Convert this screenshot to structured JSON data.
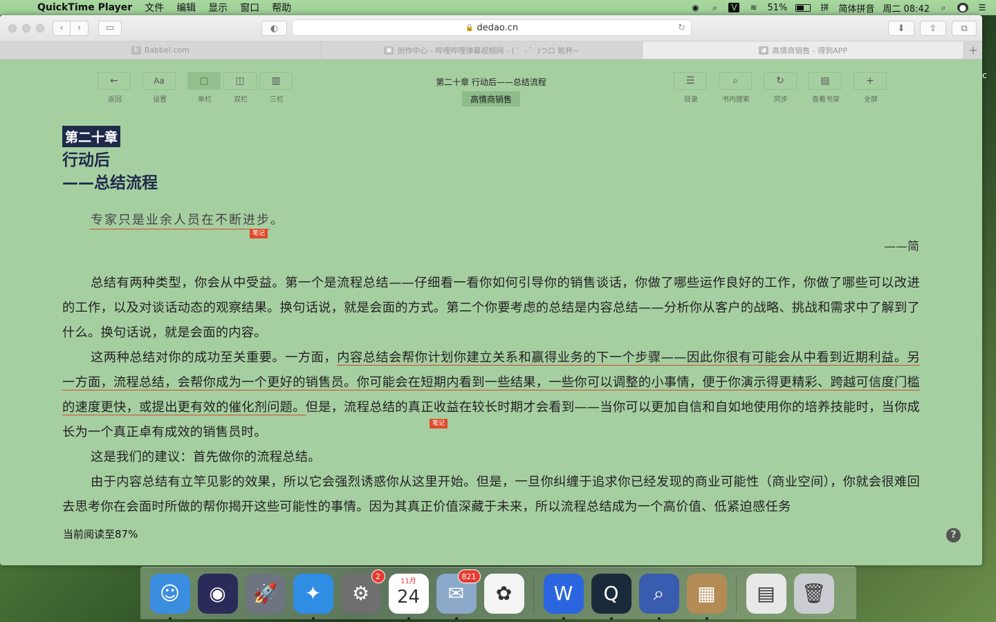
{
  "menubar": {
    "app_name": "QuickTime Player",
    "items": [
      "文件",
      "编辑",
      "显示",
      "窗口",
      "帮助"
    ],
    "battery": "51%",
    "input_method": "简体拼音",
    "clock": "周二 08:42"
  },
  "browser": {
    "url": "dedao.cn",
    "tabs": [
      {
        "label": "Babbel.com",
        "icon": "babbel-icon"
      },
      {
        "label": "创作中心 - 哔哩哔哩弹幕视频网 - ( ゜- ゜)つロ 乾杯~",
        "icon": "bilibili-icon"
      },
      {
        "label": "高情商销售 - 得到APP",
        "icon": "dedao-icon"
      }
    ]
  },
  "reader": {
    "tools_left": [
      {
        "id": "back",
        "icon": "←",
        "label": "返回"
      },
      {
        "id": "settings",
        "icon": "Aa",
        "label": "设置"
      },
      {
        "id": "single",
        "icon": "▢",
        "label": "单栏",
        "selected": true
      },
      {
        "id": "double",
        "icon": "◫",
        "label": "双栏"
      },
      {
        "id": "triple",
        "icon": "▥",
        "label": "三栏"
      }
    ],
    "tools_right": [
      {
        "id": "toc",
        "icon": "☰",
        "label": "目录"
      },
      {
        "id": "search",
        "icon": "⌕",
        "label": "书内搜索"
      },
      {
        "id": "sync",
        "icon": "↻",
        "label": "同步"
      },
      {
        "id": "shelf",
        "icon": "▤",
        "label": "查看书架"
      },
      {
        "id": "fullscreen",
        "icon": "+",
        "label": "全屏"
      }
    ],
    "chapter_title": "第二十章 行动后——总结流程",
    "book_name": "高情商销售",
    "chapter_number": "第二十章",
    "heading_line1": "行动后",
    "heading_line2": "——总结流程",
    "epigraph": "专家只是业余人员在不断进步。",
    "note_label": "笔记",
    "attribution": "——简",
    "para1": "总结有两种类型，你会从中受益。第一个是流程总结——仔细看一看你如何引导你的销售谈话，你做了哪些运作良好的工作，你做了哪些可以改进的工作，以及对谈话动态的观察结果。换句话说，就是会面的方式。第二个你要考虑的总结是内容总结——分析你从客户的战略、挑战和需求中了解到了什么。换句话说，就是会面的内容。",
    "para2_pre": "这两种总结对你的成功至关重要。一方面，",
    "para2_underlined": "内容总结会帮你计划你建立关系和赢得业务的下一个步骤——因此你很有可能会从中看到近期利益。另一方面，流程总结，会帮你成为一个更好的销售员。你可能会在短期内看到一些结果，一些你可以调整的小事情，便于你演示得更精彩、跨越可信度门槛的速度更快，或提出更有效的催化剂问题。",
    "para2_post": "但是，流程总结的真正收益在较长时期才会看到——当你可以更加自信和自如地使用你的培养技能时，当你成长为一个真正卓有成效的销售员时。",
    "para3": "这是我们的建议：首先做你的流程总结。",
    "para4": "由于内容总结有立竿见影的效果，所以它会强烈诱惑你从这里开始。但是，一旦你纠缠于追求你已经发现的商业可能性（商业空间），你就会很难回去思考你在会面时所做的帮你揭开这些可能性的事情。因为其真正价值深藏于未来，所以流程总结成为一个高价值、低紧迫感任务",
    "progress": "当前阅读至87%",
    "help": "?"
  },
  "dock": {
    "apps": [
      {
        "name": "finder-icon",
        "color": "#3b8de0",
        "glyph": "☺"
      },
      {
        "name": "siri-icon",
        "color": "#2b2b5a",
        "glyph": "◉"
      },
      {
        "name": "launchpad-icon",
        "color": "#6e7580",
        "glyph": "🚀"
      },
      {
        "name": "safari-icon",
        "color": "#2f8de4",
        "glyph": "✦"
      },
      {
        "name": "system-preferences-icon",
        "color": "#6f6f6f",
        "glyph": "⚙",
        "badge": "2"
      },
      {
        "name": "calendar-icon",
        "color": "#ffffff",
        "glyph": "24",
        "sub": "11月"
      },
      {
        "name": "mail-icon",
        "color": "#8ca9c9",
        "glyph": "✉",
        "badge": "821"
      },
      {
        "name": "photos-icon",
        "color": "#f4f4f4",
        "glyph": "✿"
      },
      {
        "name": "wps-icon",
        "color": "#2b66e0",
        "glyph": "W"
      },
      {
        "name": "quicktime-icon",
        "color": "#1b2a3a",
        "glyph": "Q"
      },
      {
        "name": "french-flag-search-icon",
        "color": "#3a5cb0",
        "glyph": "⌕"
      },
      {
        "name": "preview-icon",
        "color": "#b48b55",
        "glyph": "▦"
      },
      {
        "name": "document-icon",
        "color": "#e8e8e8",
        "glyph": "▤"
      },
      {
        "name": "trash-icon",
        "color": "#c9cdd1",
        "glyph": "🗑"
      }
    ]
  }
}
